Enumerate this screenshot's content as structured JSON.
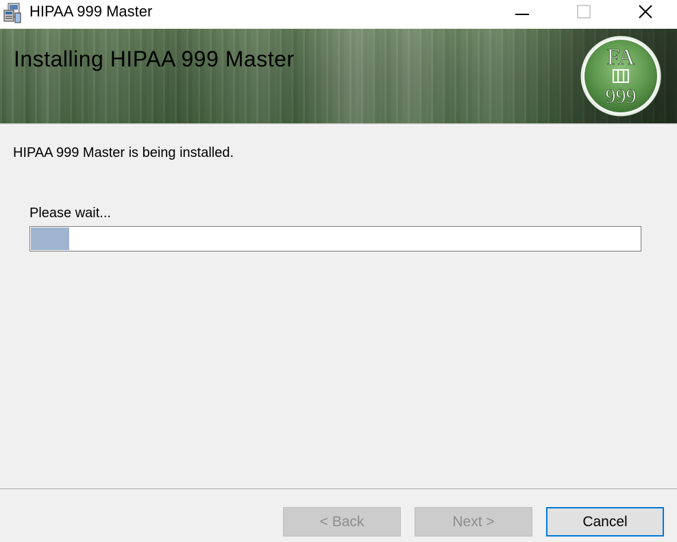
{
  "window": {
    "title": "HIPAA 999 Master",
    "icon": "installer-icon",
    "controls": {
      "minimize": "minimize-icon",
      "maximize": "maximize-icon",
      "close": "close-icon"
    }
  },
  "banner": {
    "title": "Installing HIPAA 999 Master",
    "logo": {
      "top_text": "FA",
      "bottom_text": "999"
    }
  },
  "content": {
    "status": "HIPAA 999 Master is being installed.",
    "wait_label": "Please wait...",
    "progress_fraction": 0.063
  },
  "buttons": {
    "back": "< Back",
    "next": "Next >",
    "cancel": "Cancel"
  },
  "colors": {
    "progress_fill": "#9fb4cf",
    "focus_border": "#0078d7",
    "banner_green": "#50694a",
    "logo_green": "#5f9a4f"
  }
}
